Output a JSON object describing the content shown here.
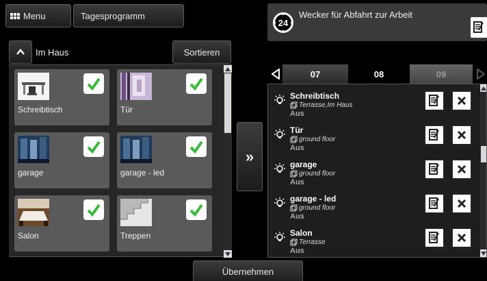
{
  "top_bar": {
    "menu_label": "Menu",
    "program_label": "Tagesprogramm"
  },
  "left_panel": {
    "room_title": "Im Haus",
    "sort_label": "Sortieren",
    "devices": [
      {
        "label": "Schreibtisch",
        "checked": true,
        "icon": "desk-photo"
      },
      {
        "label": "Tür",
        "checked": true,
        "icon": "door-photo"
      },
      {
        "label": "garage",
        "checked": true,
        "icon": "garage-photo"
      },
      {
        "label": "garage - led",
        "checked": true,
        "icon": "garage-photo"
      },
      {
        "label": "Salon",
        "checked": true,
        "icon": "salon-photo"
      },
      {
        "label": "Treppen",
        "checked": true,
        "icon": "stairs-photo"
      }
    ]
  },
  "transfer_label": "»",
  "alarm": {
    "clock_value": "24",
    "title": "Wecker für Abfahrt zur Arbeit"
  },
  "hours": {
    "tabs": [
      "07",
      "08",
      "09"
    ],
    "active": "08"
  },
  "schedule": [
    {
      "name": "Schreibtisch",
      "location": "Terrasse,Im Haus",
      "state": "Aus"
    },
    {
      "name": "Tür",
      "location": "ground floor",
      "state": "Aus"
    },
    {
      "name": "garage",
      "location": "ground floor",
      "state": "Aus"
    },
    {
      "name": "garage - led",
      "location": "ground floor",
      "state": "Aus"
    },
    {
      "name": "Salon",
      "location": "Terrasse",
      "state": "Aus"
    }
  ],
  "apply_label": "Übernehmen",
  "colors": {
    "check_green": "#3cb93c",
    "tile_bg": "#5a5a5a",
    "panel_bg": "#262626"
  }
}
